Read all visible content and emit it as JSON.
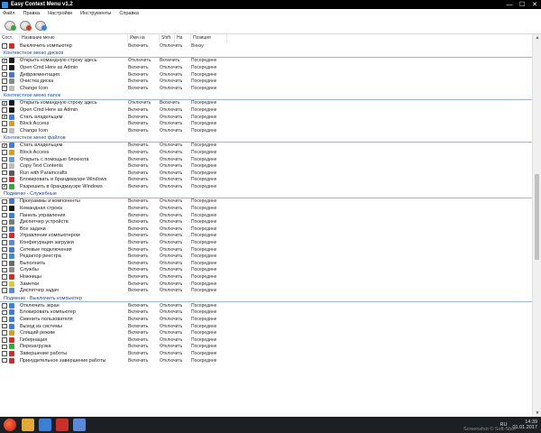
{
  "window": {
    "title": "Easy Context Menu v1.2",
    "controls": {
      "minimize": "—",
      "maximize": "☐",
      "close": "✕"
    }
  },
  "menu": [
    "Файл",
    "Правка",
    "Настройки",
    "Инструменты",
    "Справка"
  ],
  "toolbar": [
    {
      "name": "apply-changes-button",
      "badge_color": "#3aa635"
    },
    {
      "name": "remove-all-button",
      "badge_color": "#d23a2a"
    },
    {
      "name": "refresh-button",
      "badge_color": "#3a7fd8"
    }
  ],
  "columns": [
    "Сост.",
    "Название меню",
    "Имя на",
    "Shift",
    "На",
    "Позиция"
  ],
  "groups": [
    {
      "title": "",
      "items": [
        {
          "checked": false,
          "icon": "power-icon",
          "icon_color": "#c9302c",
          "name": "Выключить компьютер",
          "on": "Включить",
          "shift": "Отключить",
          "pos": "Внизу"
        }
      ]
    },
    {
      "title": "Контекстное меню дисков",
      "items": [
        {
          "checked": true,
          "icon": "cmd-icon",
          "icon_color": "#1a1a1a",
          "name": "Открыть командную строку здесь",
          "on": "Отключить",
          "shift": "Включить",
          "pos": "Посередине"
        },
        {
          "checked": false,
          "icon": "cmd-icon",
          "icon_color": "#1a1a1a",
          "name": "Open Cmd Here as Admin",
          "on": "Включить",
          "shift": "Отключить",
          "pos": "Посередине"
        },
        {
          "checked": false,
          "icon": "defrag-icon",
          "icon_color": "#4a78c8",
          "name": "Дефрагментация",
          "on": "Включить",
          "shift": "Отключить",
          "pos": "Посередине"
        },
        {
          "checked": false,
          "icon": "cleanup-icon",
          "icon_color": "#8a8a8a",
          "name": "Очистка диска",
          "on": "Включить",
          "shift": "Отключить",
          "pos": "Посередине"
        },
        {
          "checked": false,
          "icon": "change-icon",
          "icon_color": "#bcbcbc",
          "name": "Change Icon",
          "on": "Включить",
          "shift": "Отключить",
          "pos": "Посередине"
        }
      ]
    },
    {
      "title": "Контекстное меню папок",
      "items": [
        {
          "checked": true,
          "icon": "cmd-icon",
          "icon_color": "#1a1a1a",
          "name": "Открыть командную строку здесь",
          "on": "Отключить",
          "shift": "Включить",
          "pos": "Посередине"
        },
        {
          "checked": false,
          "icon": "cmd-icon",
          "icon_color": "#1a1a1a",
          "name": "Open Cmd Here as Admin",
          "on": "Включить",
          "shift": "Отключить",
          "pos": "Посередине"
        },
        {
          "checked": true,
          "icon": "owner-icon",
          "icon_color": "#3a7fd8",
          "name": "Стать владельцем",
          "on": "Включить",
          "shift": "Отключить",
          "pos": "Посередине"
        },
        {
          "checked": false,
          "icon": "lock-icon",
          "icon_color": "#d89a2a",
          "name": "Block Access",
          "on": "Включить",
          "shift": "Отключить",
          "pos": "Посередине"
        },
        {
          "checked": false,
          "icon": "change-icon",
          "icon_color": "#bcbcbc",
          "name": "Change Icon",
          "on": "Включить",
          "shift": "Отключить",
          "pos": "Посередине"
        }
      ]
    },
    {
      "title": "Контекстное меню файлов",
      "items": [
        {
          "checked": true,
          "icon": "owner-icon",
          "icon_color": "#3a7fd8",
          "name": "Стать владельцем",
          "on": "Включить",
          "shift": "Отключить",
          "pos": "Посередине"
        },
        {
          "checked": false,
          "icon": "lock-icon",
          "icon_color": "#d89a2a",
          "name": "Block Access",
          "on": "Включить",
          "shift": "Отключить",
          "pos": "Посередине"
        },
        {
          "checked": false,
          "icon": "notepad-icon",
          "icon_color": "#6a9ad8",
          "name": "Открыть с помощью блокнота",
          "on": "Включить",
          "shift": "Отключить",
          "pos": "Посередине"
        },
        {
          "checked": false,
          "icon": "copy-icon",
          "icon_color": "#bcbcbc",
          "name": "Copy Text Contents",
          "on": "Включить",
          "shift": "Отключить",
          "pos": "Посередине"
        },
        {
          "checked": false,
          "icon": "paramcrafts-icon",
          "icon_color": "#5a5a5a",
          "name": "Run with Paramcrafts",
          "on": "Включить",
          "shift": "Отключить",
          "pos": "Посередине"
        },
        {
          "checked": false,
          "icon": "firewall-block-icon",
          "icon_color": "#c9302c",
          "name": "Блокировать в брандмауэре Windows",
          "on": "Включить",
          "shift": "Отключить",
          "pos": "Посередине"
        },
        {
          "checked": true,
          "icon": "firewall-allow-icon",
          "icon_color": "#3aa635",
          "name": "Разрешить в брандмауэре Windows",
          "on": "Включить",
          "shift": "Отключить",
          "pos": "Посередине"
        }
      ]
    },
    {
      "title": "Подменю - Служебные",
      "items": [
        {
          "checked": false,
          "icon": "programs-icon",
          "icon_color": "#4a78c8",
          "name": "Программы и компоненты",
          "on": "Включить",
          "shift": "Отключить",
          "pos": "Посередине"
        },
        {
          "checked": false,
          "icon": "cmd-icon",
          "icon_color": "#1a1a1a",
          "name": "Командная строка",
          "on": "Включить",
          "shift": "Отключить",
          "pos": "Посередине"
        },
        {
          "checked": false,
          "icon": "control-panel-icon",
          "icon_color": "#3a7fd8",
          "name": "Панель управления",
          "on": "Включить",
          "shift": "Отключить",
          "pos": "Посередине"
        },
        {
          "checked": false,
          "icon": "device-manager-icon",
          "icon_color": "#7a7a7a",
          "name": "Диспетчер устройств",
          "on": "Включить",
          "shift": "Отключить",
          "pos": "Посередине"
        },
        {
          "checked": false,
          "icon": "tasks-icon",
          "icon_color": "#4a78c8",
          "name": "Все задачи",
          "on": "Включить",
          "shift": "Отключить",
          "pos": "Посередине"
        },
        {
          "checked": false,
          "icon": "computer-management-icon",
          "icon_color": "#c9302c",
          "name": "Управление компьютером",
          "on": "Включить",
          "shift": "Отключить",
          "pos": "Посередине"
        },
        {
          "checked": false,
          "icon": "msconfig-icon",
          "icon_color": "#5a8ad8",
          "name": "Конфигурация загрузки",
          "on": "Включить",
          "shift": "Отключить",
          "pos": "Посередине"
        },
        {
          "checked": false,
          "icon": "network-icon",
          "icon_color": "#4a78c8",
          "name": "Сетевые подключения",
          "on": "Включить",
          "shift": "Отключить",
          "pos": "Посередине"
        },
        {
          "checked": false,
          "icon": "registry-icon",
          "icon_color": "#3a8fc8",
          "name": "Редактор реестра",
          "on": "Включить",
          "shift": "Отключить",
          "pos": "Посередине"
        },
        {
          "checked": false,
          "icon": "run-icon",
          "icon_color": "#6a6a6a",
          "name": "Выполнить",
          "on": "Включить",
          "shift": "Отключить",
          "pos": "Посередине"
        },
        {
          "checked": false,
          "icon": "services-icon",
          "icon_color": "#8a8a8a",
          "name": "Службы",
          "on": "Включить",
          "shift": "Отключить",
          "pos": "Посередине"
        },
        {
          "checked": false,
          "icon": "scissors-icon",
          "icon_color": "#c9302c",
          "name": "Ножницы",
          "on": "Включить",
          "shift": "Отключить",
          "pos": "Посередине"
        },
        {
          "checked": false,
          "icon": "notes-icon",
          "icon_color": "#d8c84a",
          "name": "Заметки",
          "on": "Включить",
          "shift": "Отключить",
          "pos": "Посередине"
        },
        {
          "checked": false,
          "icon": "task-manager-icon",
          "icon_color": "#5a8ad8",
          "name": "Диспетчер задач",
          "on": "Включить",
          "shift": "Отключить",
          "pos": "Посередине"
        }
      ]
    },
    {
      "title": "Подменю - Выключить компьютер",
      "items": [
        {
          "checked": false,
          "icon": "display-off-icon",
          "icon_color": "#3a7fd8",
          "name": "Отключить экран",
          "on": "Включить",
          "shift": "Отключить",
          "pos": "Посередине"
        },
        {
          "checked": false,
          "icon": "lock-screen-icon",
          "icon_color": "#3a7fd8",
          "name": "Блокировать компьютер",
          "on": "Включить",
          "shift": "Отключить",
          "pos": "Посередине"
        },
        {
          "checked": false,
          "icon": "switch-user-icon",
          "icon_color": "#3a7fd8",
          "name": "Сменить пользователя",
          "on": "Включить",
          "shift": "Отключить",
          "pos": "Посередине"
        },
        {
          "checked": false,
          "icon": "logoff-icon",
          "icon_color": "#3a7fd8",
          "name": "Выход из системы",
          "on": "Включить",
          "shift": "Отключить",
          "pos": "Посередине"
        },
        {
          "checked": false,
          "icon": "sleep-icon",
          "icon_color": "#d89a2a",
          "name": "Спящий режим",
          "on": "Включить",
          "shift": "Отключить",
          "pos": "Посередине"
        },
        {
          "checked": false,
          "icon": "hibernate-icon",
          "icon_color": "#c9302c",
          "name": "Гибернация",
          "on": "Включить",
          "shift": "Отключить",
          "pos": "Посередине"
        },
        {
          "checked": false,
          "icon": "restart-icon",
          "icon_color": "#3aa635",
          "name": "Перезагрузка",
          "on": "Включить",
          "shift": "Отключить",
          "pos": "Посередине"
        },
        {
          "checked": false,
          "icon": "shutdown-icon",
          "icon_color": "#c9302c",
          "name": "Завершение работы",
          "on": "Включить",
          "shift": "Отключить",
          "pos": "Посередине"
        },
        {
          "checked": false,
          "icon": "force-shutdown-icon",
          "icon_color": "#c9302c",
          "name": "Принудительное завершение работы",
          "on": "Включить",
          "shift": "Отключить",
          "pos": "Посередине"
        }
      ]
    }
  ],
  "taskbar": {
    "apps": [
      {
        "name": "explorer-icon",
        "color": "#e2a83a"
      },
      {
        "name": "browser-icon",
        "color": "#3a7fd8"
      },
      {
        "name": "media-icon",
        "color": "#c9302c"
      },
      {
        "name": "easy-context-menu-icon",
        "color": "#5a8ad8"
      }
    ],
    "lang": "RU",
    "time": "14:39",
    "date": "01.01.2017"
  },
  "watermark": "Screenshot © Soft-Sbor"
}
